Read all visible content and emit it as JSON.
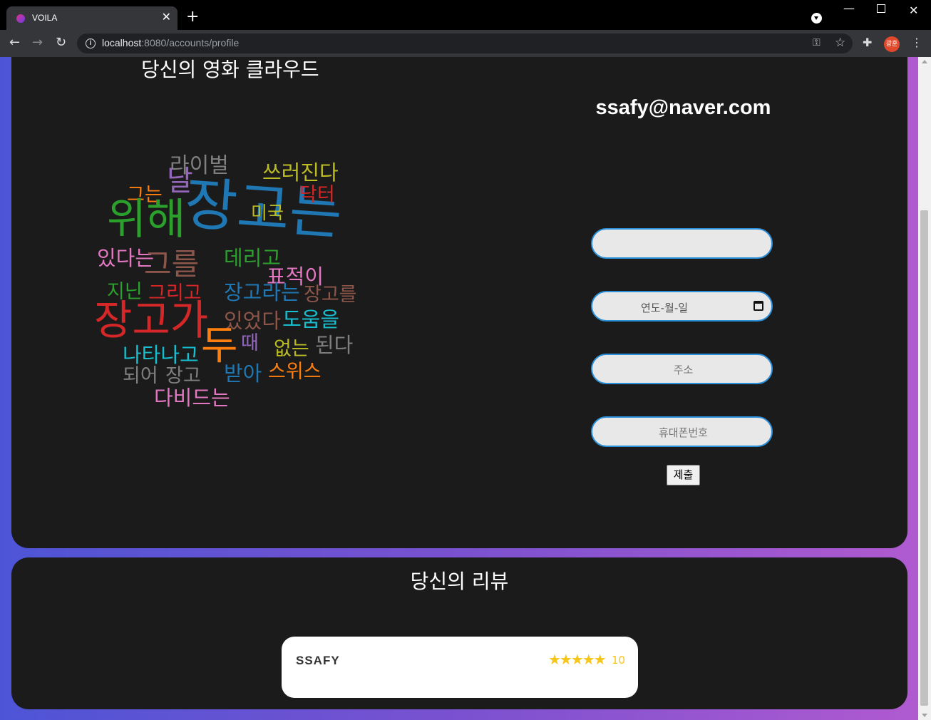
{
  "browser": {
    "tab_title": "VOILA",
    "url_host": "localhost",
    "url_path": ":8080/accounts/profile",
    "profile_initials": "광훈"
  },
  "cloud": {
    "title": "당신의 영화 클라우드",
    "words": [
      {
        "text": "라이벌",
        "color": "#7f7f7f"
      },
      {
        "text": "쓰러진다",
        "color": "#bcbd22"
      },
      {
        "text": "날",
        "color": "#9467bd"
      },
      {
        "text": "그는",
        "color": "#ff7f0e"
      },
      {
        "text": "장고는",
        "color": "#1f77b4"
      },
      {
        "text": "닥터",
        "color": "#d62728"
      },
      {
        "text": "위해",
        "color": "#2ca02c"
      },
      {
        "text": "미국",
        "color": "#bcbd22"
      },
      {
        "text": "있다는",
        "color": "#e377c2"
      },
      {
        "text": "그를",
        "color": "#8c564b"
      },
      {
        "text": "데리고",
        "color": "#2ca02c"
      },
      {
        "text": "표적이",
        "color": "#e377c2"
      },
      {
        "text": "지닌",
        "color": "#2ca02c"
      },
      {
        "text": "그리고",
        "color": "#d62728"
      },
      {
        "text": "장고라는",
        "color": "#1f77b4"
      },
      {
        "text": "장고를",
        "color": "#8c564b"
      },
      {
        "text": "장고가",
        "color": "#d62728"
      },
      {
        "text": "있었다",
        "color": "#8c564b"
      },
      {
        "text": "도움을",
        "color": "#17becf"
      },
      {
        "text": "두",
        "color": "#ff7f0e"
      },
      {
        "text": "때",
        "color": "#9467bd"
      },
      {
        "text": "없는",
        "color": "#bcbd22"
      },
      {
        "text": "된다",
        "color": "#7f7f7f"
      },
      {
        "text": "나타나고",
        "color": "#17becf"
      },
      {
        "text": "되어",
        "color": "#7f7f7f"
      },
      {
        "text": "장고",
        "color": "#7f7f7f"
      },
      {
        "text": "받아",
        "color": "#1f77b4"
      },
      {
        "text": "스위스",
        "color": "#ff7f0e"
      },
      {
        "text": "다비드는",
        "color": "#e377c2"
      }
    ]
  },
  "profile": {
    "email": "ssafy@naver.com",
    "name_value": "",
    "date_placeholder": "연도-월-일",
    "address_placeholder": "주소",
    "phone_placeholder": "휴대폰번호",
    "submit_label": "제출"
  },
  "reviews": {
    "title": "당신의 리뷰",
    "items": [
      {
        "author": "SSAFY",
        "stars": "★★★★★",
        "score": "10"
      }
    ]
  }
}
